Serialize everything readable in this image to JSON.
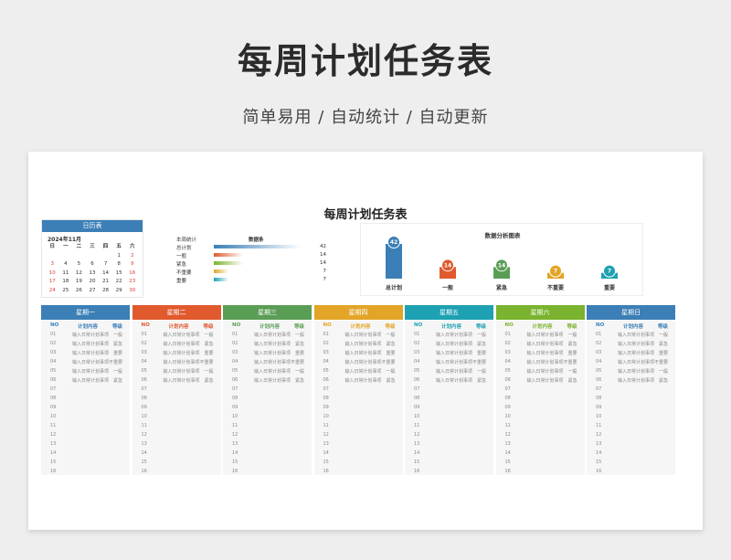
{
  "banner": {
    "title": "每周计划任务表",
    "subtitle": "简单易用  /  自动统计  /  自动更新"
  },
  "sheet": {
    "title": "每周计划任务表"
  },
  "calendar": {
    "header": "日历表",
    "month": "2024年11月",
    "weekdays": [
      "日",
      "一",
      "二",
      "三",
      "四",
      "五",
      "六"
    ],
    "weeks": [
      [
        "",
        "",
        "",
        "",
        "",
        "1",
        "2"
      ],
      [
        "3",
        "4",
        "5",
        "6",
        "7",
        "8",
        "9"
      ],
      [
        "10",
        "11",
        "12",
        "13",
        "14",
        "15",
        "16"
      ],
      [
        "17",
        "18",
        "19",
        "20",
        "21",
        "22",
        "23"
      ],
      [
        "24",
        "25",
        "26",
        "27",
        "28",
        "29",
        "30"
      ]
    ]
  },
  "stats": {
    "title": "本周统计",
    "bar_title": "数据条",
    "rows": [
      {
        "label": "总计划",
        "value": 42,
        "color": "#3b7fb6"
      },
      {
        "label": "一般",
        "value": 14,
        "color": "#e05a2e"
      },
      {
        "label": "紧急",
        "value": 14,
        "color": "#7ab32e"
      },
      {
        "label": "不重要",
        "value": 7,
        "color": "#e2a528"
      },
      {
        "label": "重要",
        "value": 7,
        "color": "#1ea1b2"
      }
    ]
  },
  "chart_data": {
    "type": "bar",
    "title": "数据分析图表",
    "categories": [
      "总计划",
      "一般",
      "紧急",
      "不重要",
      "重要"
    ],
    "values": [
      42,
      14,
      14,
      7,
      7
    ],
    "colors": [
      "#3b7fb6",
      "#e05a2e",
      "#5a9e55",
      "#e2a528",
      "#1ea1b2"
    ],
    "ylim": [
      0,
      42
    ]
  },
  "days": [
    {
      "name": "星期一",
      "color": "#3b7fb6"
    },
    {
      "name": "星期二",
      "color": "#e05a2e"
    },
    {
      "name": "星期三",
      "color": "#5a9e55"
    },
    {
      "name": "星期四",
      "color": "#e2a528"
    },
    {
      "name": "星期五",
      "color": "#1ea1b2"
    },
    {
      "name": "星期六",
      "color": "#7ab32e"
    },
    {
      "name": "星期日",
      "color": "#3b7fb6"
    }
  ],
  "table_header": {
    "no": "NO",
    "task": "计划内容",
    "level": "等级"
  },
  "table_rows": [
    {
      "no": "01",
      "task": "输入日常计划事项",
      "level": "一般"
    },
    {
      "no": "02",
      "task": "输入日常计划事项",
      "level": "紧急"
    },
    {
      "no": "03",
      "task": "输入日常计划事项",
      "level": "重要"
    },
    {
      "no": "04",
      "task": "输入日常计划事项",
      "level": "不重要"
    },
    {
      "no": "05",
      "task": "输入日常计划事项",
      "level": "一般"
    },
    {
      "no": "06",
      "task": "输入日常计划事项",
      "level": "紧急"
    },
    {
      "no": "07",
      "task": "",
      "level": ""
    },
    {
      "no": "08",
      "task": "",
      "level": ""
    },
    {
      "no": "09",
      "task": "",
      "level": ""
    },
    {
      "no": "10",
      "task": "",
      "level": ""
    },
    {
      "no": "11",
      "task": "",
      "level": ""
    },
    {
      "no": "12",
      "task": "",
      "level": ""
    },
    {
      "no": "13",
      "task": "",
      "level": ""
    },
    {
      "no": "14",
      "task": "",
      "level": ""
    },
    {
      "no": "15",
      "task": "",
      "level": ""
    },
    {
      "no": "16",
      "task": "",
      "level": ""
    }
  ]
}
